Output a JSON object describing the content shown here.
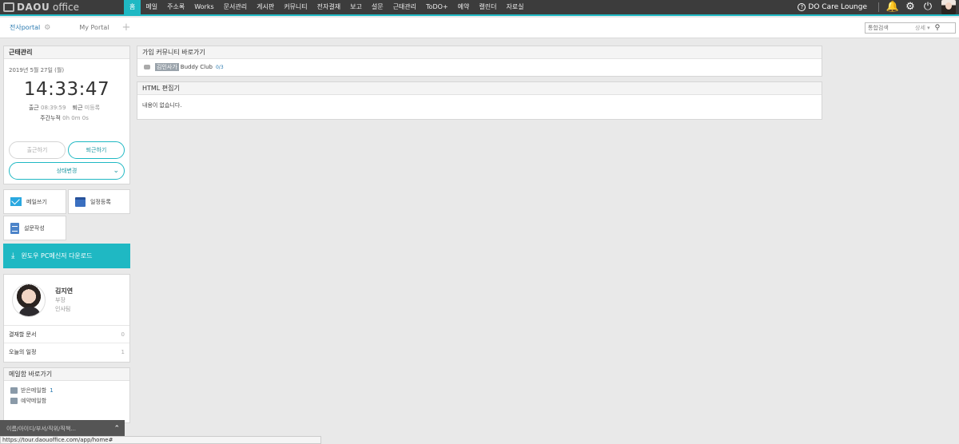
{
  "logo": {
    "brand": "DAOU",
    "product": "office"
  },
  "nav": {
    "items": [
      "홈",
      "메일",
      "주소록",
      "Works",
      "문서관리",
      "게시판",
      "커뮤니티",
      "전자결재",
      "보고",
      "설문",
      "근태관리",
      "ToDO+",
      "예약",
      "캘린더",
      "자료실"
    ],
    "care_lounge": "DO Care Lounge"
  },
  "tabs": {
    "company": "전사portal",
    "my": "My Portal"
  },
  "search": {
    "placeholder": "통합검색",
    "detail": "상세 ▾"
  },
  "attendance": {
    "title": "근태관리",
    "date": "2019년 5월 27일 (월)",
    "time": "14:33:47",
    "checkin_label": "출근",
    "checkin_value": "08:39:59",
    "checkout_label": "퇴근",
    "checkout_value": "미등록",
    "weekly_label": "주간누적",
    "weekly_value": "0h 0m 0s",
    "checkin_button": "출근하기",
    "checkout_button": "퇴근하기",
    "status_button": "상태변경"
  },
  "quick": {
    "write_mail": "메일쓰기",
    "add_schedule": "일정등록",
    "write_survey": "설문작성"
  },
  "download": {
    "label": "윈도우 PC메신저 다운로드"
  },
  "profile": {
    "name": "김지연",
    "position": "부장",
    "team": "인사팀",
    "rows": [
      {
        "label": "결재할 문서",
        "count": "0"
      },
      {
        "label": "오늘의 일정",
        "count": "1"
      }
    ]
  },
  "mailbox": {
    "title": "메일함 바로가기",
    "items": [
      {
        "label": "받은메일함",
        "count": "1"
      },
      {
        "label": "예약메일함",
        "count": ""
      }
    ]
  },
  "community": {
    "title": "가입 커뮤니티 바로가기",
    "tag": "김인사가",
    "name": "Buddy Club",
    "count": "0/3"
  },
  "html_editor": {
    "title": "HTML 편집기",
    "empty": "내용이 없습니다."
  },
  "chatbar": {
    "placeholder": "이름/아이디/부서/직위/직책..."
  },
  "statusbar": {
    "url": "https://tour.daouoffice.com/app/home#"
  },
  "colors": {
    "accent": "#1fb8c3",
    "nav_bg": "#3c3c3c"
  }
}
